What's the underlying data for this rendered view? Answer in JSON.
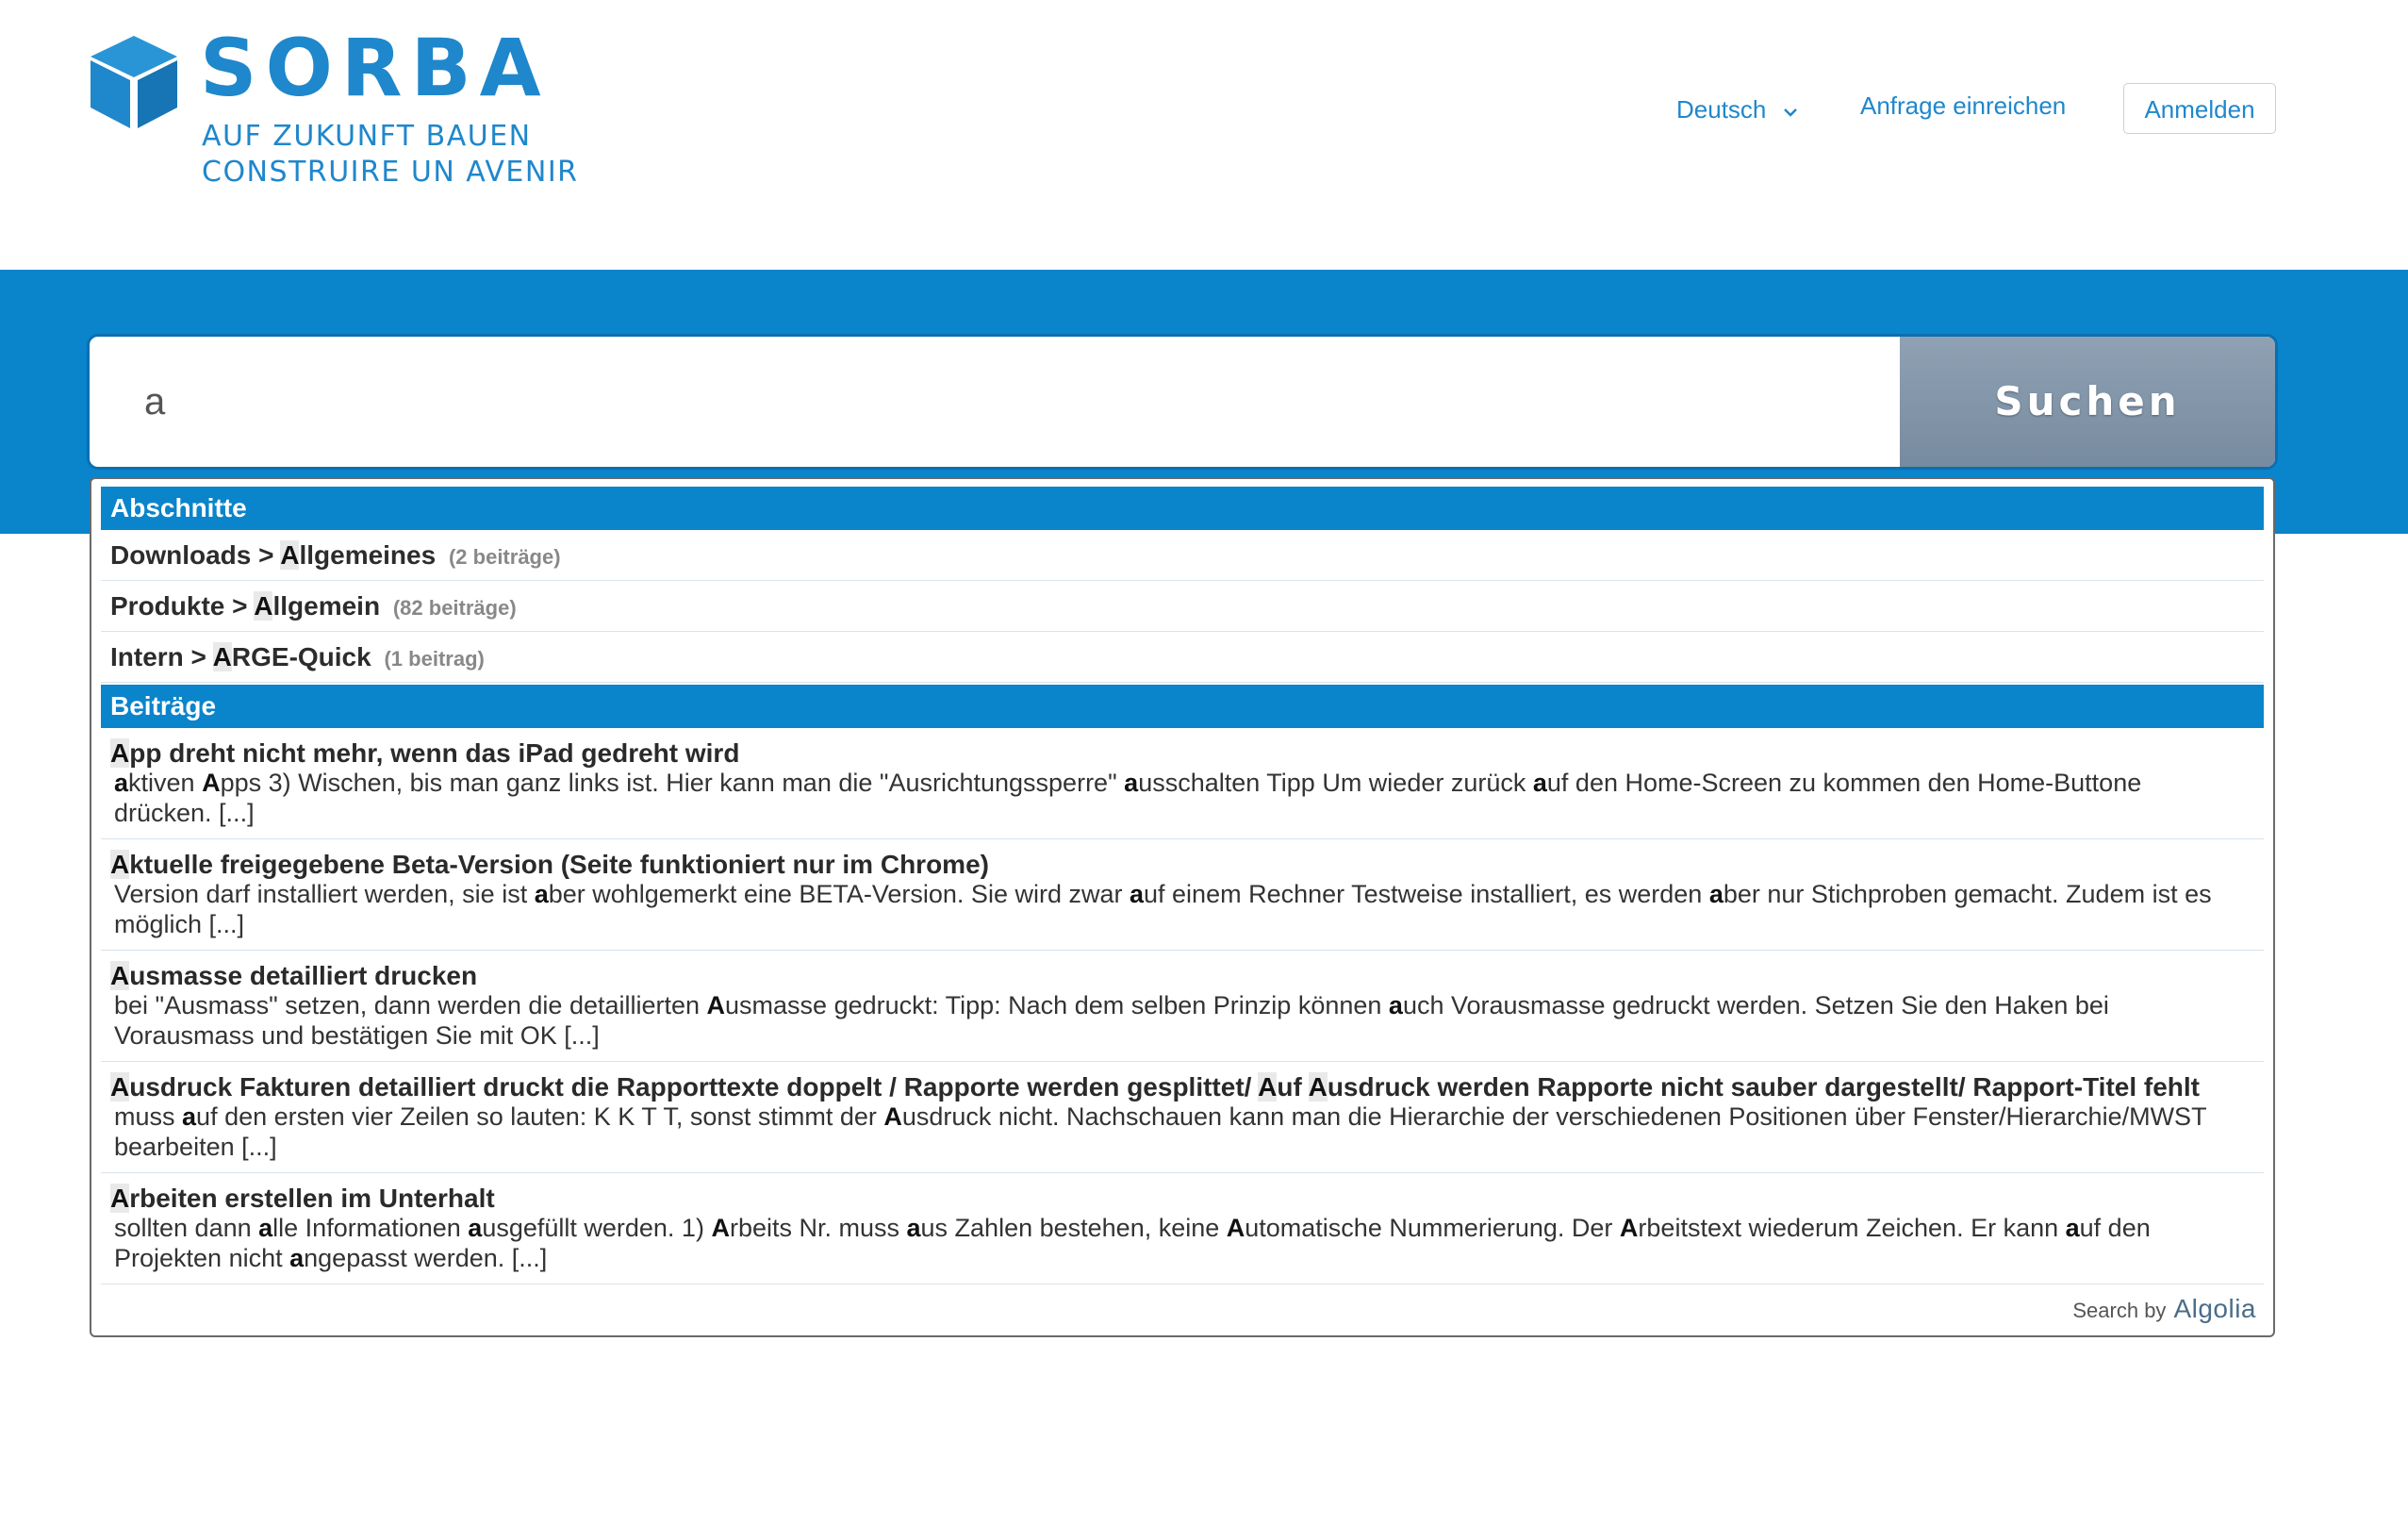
{
  "brand": {
    "name": "SORBA",
    "tagline_de": "AUF ZUKUNFT BAUEN",
    "tagline_fr": "CONSTRUIRE UN AVENIR"
  },
  "nav": {
    "language": "Deutsch",
    "submit_request": "Anfrage einreichen",
    "login": "Anmelden"
  },
  "search": {
    "query": "a",
    "button_label": "Suchen"
  },
  "sections": {
    "header": "Abschnitte",
    "items": [
      {
        "path": "Downloads > ",
        "hl": "A",
        "rest": "llgemeines",
        "count": "(2 beiträge)"
      },
      {
        "path": "Produkte > ",
        "hl": "A",
        "rest": "llgemein",
        "count": "(82 beiträge)"
      },
      {
        "path": "Intern > ",
        "hl": "A",
        "rest": "RGE-Quick",
        "count": "(1 beitrag)"
      }
    ]
  },
  "posts": {
    "header": "Beiträge",
    "items": [
      {
        "title": "App dreht nicht mehr, wenn das iPad gedreht wird",
        "snippet": "aktiven Apps 3) Wischen, bis man ganz links ist. Hier kann man die \"Ausrichtungssperre\" ausschalten Tipp Um wieder zurück auf den Home-Screen zu kommen den Home-Buttone drücken. [...]"
      },
      {
        "title": "Aktuelle freigegebene Beta-Version (Seite funktioniert nur im Chrome)",
        "snippet": "Version darf installiert werden, sie ist aber wohlgemerkt eine BETA-Version. Sie wird zwar auf einem Rechner Testweise installiert, es werden aber nur Stichproben gemacht. Zudem ist es möglich [...]"
      },
      {
        "title": "Ausmasse detailliert drucken",
        "snippet": "bei \"Ausmass\" setzen, dann werden die detaillierten Ausmasse gedruckt:  Tipp: Nach dem selben Prinzip können auch Vorausmasse gedruckt werden. Setzen Sie den Haken bei Vorausmass und bestätigen Sie mit OK [...]"
      },
      {
        "title": "Ausdruck Fakturen detailliert druckt die Rapporttexte doppelt / Rapporte werden gesplittet/ Auf Ausdruck werden Rapporte nicht sauber dargestellt/ Rapport-Titel fehlt",
        "snippet": "muss auf den ersten vier Zeilen so lauten: K K T T, sonst stimmt der Ausdruck nicht. Nachschauen kann man die Hierarchie der verschiedenen Positionen über Fenster/Hierarchie/MWST bearbeiten [...]"
      },
      {
        "title": "Arbeiten erstellen im Unterhalt",
        "snippet": "sollten dann alle Informationen ausgefüllt werden. 1) Arbeits Nr. muss aus Zahlen bestehen, keine Automatische Nummerierung. Der Arbeitstext wiederum Zeichen. Er kann auf den Projekten nicht angepasst werden. [...]"
      }
    ]
  },
  "footer": {
    "search_by": "Search by",
    "provider": "Algolia"
  },
  "colors": {
    "brand_blue": "#1f87cc",
    "band_blue": "#0a84cb",
    "button_gray": "#8496a9"
  }
}
